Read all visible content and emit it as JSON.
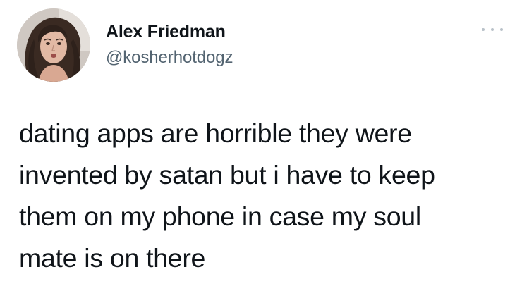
{
  "author": {
    "display_name": "Alex Friedman",
    "handle": "@kosherhotdogz",
    "avatar_icon": "profile-photo"
  },
  "more_icon": "more-horizontal-icon",
  "tweet": {
    "lines": [
      "dating apps are horrible they were",
      "invented by satan but i have to keep",
      "them on my phone in case my soul",
      "mate is on there"
    ]
  },
  "colors": {
    "text_primary": "#0f1419",
    "text_secondary": "#536471",
    "more_dots": "#b9c2c9",
    "background": "#ffffff"
  }
}
